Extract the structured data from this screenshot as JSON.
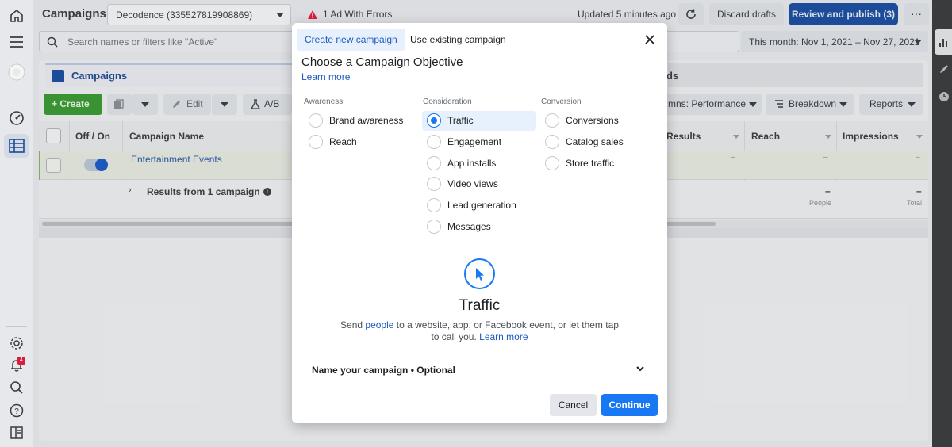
{
  "topbar": {
    "title": "Campaigns",
    "account": "Decodence (335527819908869)",
    "error_text": "1 Ad With Errors",
    "updated": "Updated 5 minutes ago",
    "discard_label": "Discard drafts",
    "publish_label": "Review and publish (3)",
    "more_label": "···"
  },
  "search": {
    "placeholder": "Search names or filters like \"Active\"",
    "date_range": "This month: Nov 1, 2021 – Nov 27, 2021"
  },
  "tabs": {
    "campaigns": "Campaigns",
    "ads_partial": "ds"
  },
  "toolbar": {
    "create_label": "Create",
    "edit_label": "Edit",
    "ab_test_label": "A/B Te",
    "columns_label": "mns: Performance",
    "breakdown_label": "Breakdown",
    "reports_label": "Reports"
  },
  "table": {
    "headers": {
      "off_on": "Off / On",
      "campaign_name": "Campaign Name",
      "results": "Results",
      "reach": "Reach",
      "impressions": "Impressions"
    },
    "row": {
      "name": "Entertainment Events",
      "results": "–",
      "reach": "–",
      "impressions": "–"
    },
    "summary": {
      "label": "Results from 1 campaign",
      "reach_value": "–",
      "reach_sub": "People",
      "impressions_value": "–",
      "impressions_sub": "Total"
    }
  },
  "rail": {
    "notification_count": "4"
  },
  "modal": {
    "tab_new": "Create new campaign",
    "tab_existing": "Use existing campaign",
    "title": "Choose a Campaign Objective",
    "learn_more": "Learn more",
    "columns": [
      {
        "heading": "Awareness",
        "options": [
          {
            "label": "Brand awareness",
            "selected": false
          },
          {
            "label": "Reach",
            "selected": false
          }
        ]
      },
      {
        "heading": "Consideration",
        "options": [
          {
            "label": "Traffic",
            "selected": true
          },
          {
            "label": "Engagement",
            "selected": false
          },
          {
            "label": "App installs",
            "selected": false
          },
          {
            "label": "Video views",
            "selected": false
          },
          {
            "label": "Lead generation",
            "selected": false
          },
          {
            "label": "Messages",
            "selected": false
          }
        ]
      },
      {
        "heading": "Conversion",
        "options": [
          {
            "label": "Conversions",
            "selected": false
          },
          {
            "label": "Catalog sales",
            "selected": false
          },
          {
            "label": "Store traffic",
            "selected": false
          }
        ]
      }
    ],
    "detail": {
      "icon": "cursor-icon",
      "title": "Traffic",
      "desc_before": "Send ",
      "desc_link1": "people",
      "desc_after": " to a website, app, or Facebook event, or let them tap to call you. ",
      "desc_link2": "Learn more"
    },
    "name_campaign": "Name your campaign • Optional",
    "cancel_label": "Cancel",
    "continue_label": "Continue"
  },
  "colors": {
    "primary_blue": "#1877f2",
    "publish_blue": "#1e4fa0",
    "create_green": "#3d9a35",
    "error_red": "#e41e3f"
  }
}
